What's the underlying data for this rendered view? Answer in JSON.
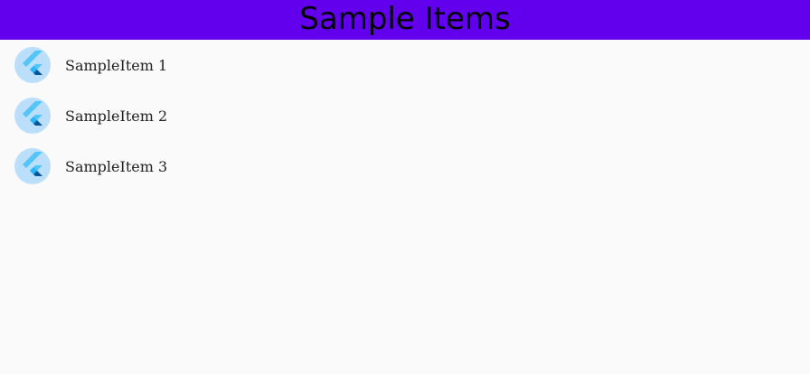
{
  "app_bar": {
    "title": "Sample Items",
    "background_color": "#6200ee"
  },
  "list": {
    "items": [
      {
        "label": "SampleItem 1",
        "icon": "flutter-logo-icon"
      },
      {
        "label": "SampleItem 2",
        "icon": "flutter-logo-icon"
      },
      {
        "label": "SampleItem 3",
        "icon": "flutter-logo-icon"
      }
    ]
  },
  "colors": {
    "avatar_bg": "#bbdefb",
    "logo_light": "#54c5f8",
    "logo_mid": "#29b6f6",
    "logo_dark": "#01579b",
    "page_bg": "#fafafa"
  }
}
